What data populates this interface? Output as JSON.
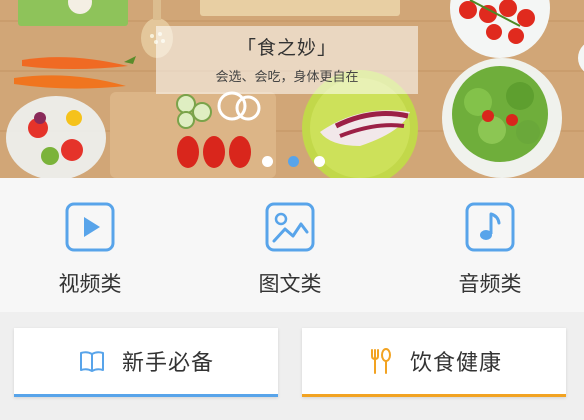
{
  "banner": {
    "title": "「食之妙」",
    "subtitle": "会选、会吃，身体更自在",
    "indicator": {
      "count": 3,
      "active_index": 1
    },
    "colors": {
      "active_dot": "#58a4ea",
      "inactive_dot": "#ffffff"
    }
  },
  "categories": [
    {
      "label": "视频类",
      "icon": "play-icon"
    },
    {
      "label": "图文类",
      "icon": "image-icon"
    },
    {
      "label": "音频类",
      "icon": "music-note-icon"
    }
  ],
  "actions": [
    {
      "label": "新手必备",
      "icon": "book-icon",
      "accent": "#58a4ea"
    },
    {
      "label": "饮食健康",
      "icon": "fork-spoon-icon",
      "accent": "#f2a322"
    }
  ],
  "theme": {
    "icon_blue": "#58a4ea",
    "text": "#333333"
  }
}
